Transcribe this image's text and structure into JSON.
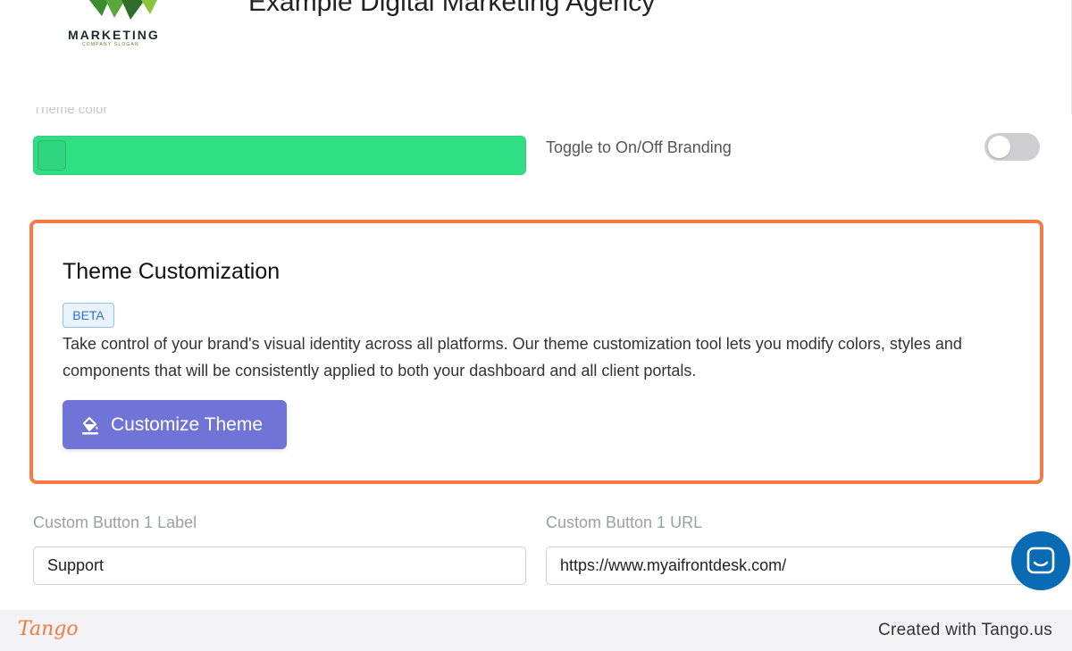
{
  "header": {
    "logo_text": "MARKETING",
    "logo_slogan": "COMPANY SLOGAN",
    "agency_name": "Example Digital Marketing Agency"
  },
  "branding": {
    "theme_color_label": "Theme color",
    "theme_color_value": "#30de84",
    "toggle_label": "Toggle to On/Off Branding",
    "toggle_state": "off"
  },
  "theme_customization": {
    "title": "Theme Customization",
    "badge": "BETA",
    "description": "Take control of your brand's visual identity across all platforms. Our theme customization tool lets you modify colors, styles and components that will be consistently applied to both your dashboard and all client portals.",
    "button_label": "Customize Theme",
    "button_icon": "paint-bucket-icon",
    "highlight_color": "#f57a43",
    "button_color": "#7074d7"
  },
  "custom_button": {
    "label_field_label": "Custom Button 1 Label",
    "label_field_value": "Support",
    "url_field_label": "Custom Button 1 URL",
    "url_field_value": "https://www.myaifrontdesk.com/"
  },
  "chat": {
    "icon": "chat-icon"
  },
  "footer": {
    "brand": "Tango",
    "credit": "Created with Tango.us"
  }
}
